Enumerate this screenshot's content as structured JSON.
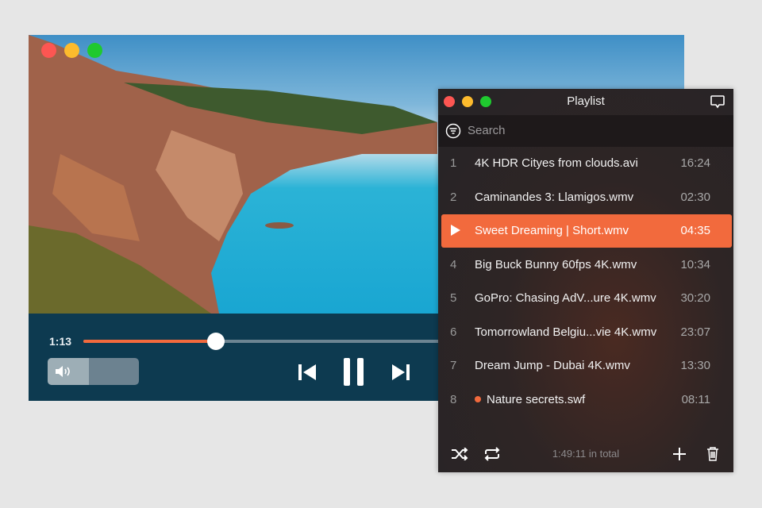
{
  "player": {
    "current_time": "1:13",
    "progress": 0.23,
    "volume": 0.45,
    "colors": {
      "accent": "#f26a3d",
      "controls_bg": "#0d3a50"
    }
  },
  "playlist": {
    "title": "Playlist",
    "search_placeholder": "Search",
    "total": "1:49:11 in total",
    "items": [
      {
        "n": "1",
        "title": "4K HDR Cityes from clouds.avi",
        "duration": "16:24"
      },
      {
        "n": "2",
        "title": "Caminandes 3: Llamigos.wmv",
        "duration": "02:30"
      },
      {
        "n": "3",
        "title": "Sweet Dreaming | Short.wmv",
        "duration": "04:35",
        "playing": true
      },
      {
        "n": "4",
        "title": "Big Buck Bunny 60fps 4K.wmv",
        "duration": "10:34"
      },
      {
        "n": "5",
        "title": "GoPro: Chasing AdV...ure 4K.wmv",
        "duration": "30:20"
      },
      {
        "n": "6",
        "title": "Tomorrowland Belgiu...vie 4K.wmv",
        "duration": "23:07"
      },
      {
        "n": "7",
        "title": "Dream Jump - Dubai 4K.wmv",
        "duration": "13:30"
      },
      {
        "n": "8",
        "title": "Nature secrets.swf",
        "duration": "08:11",
        "new": true
      }
    ]
  }
}
